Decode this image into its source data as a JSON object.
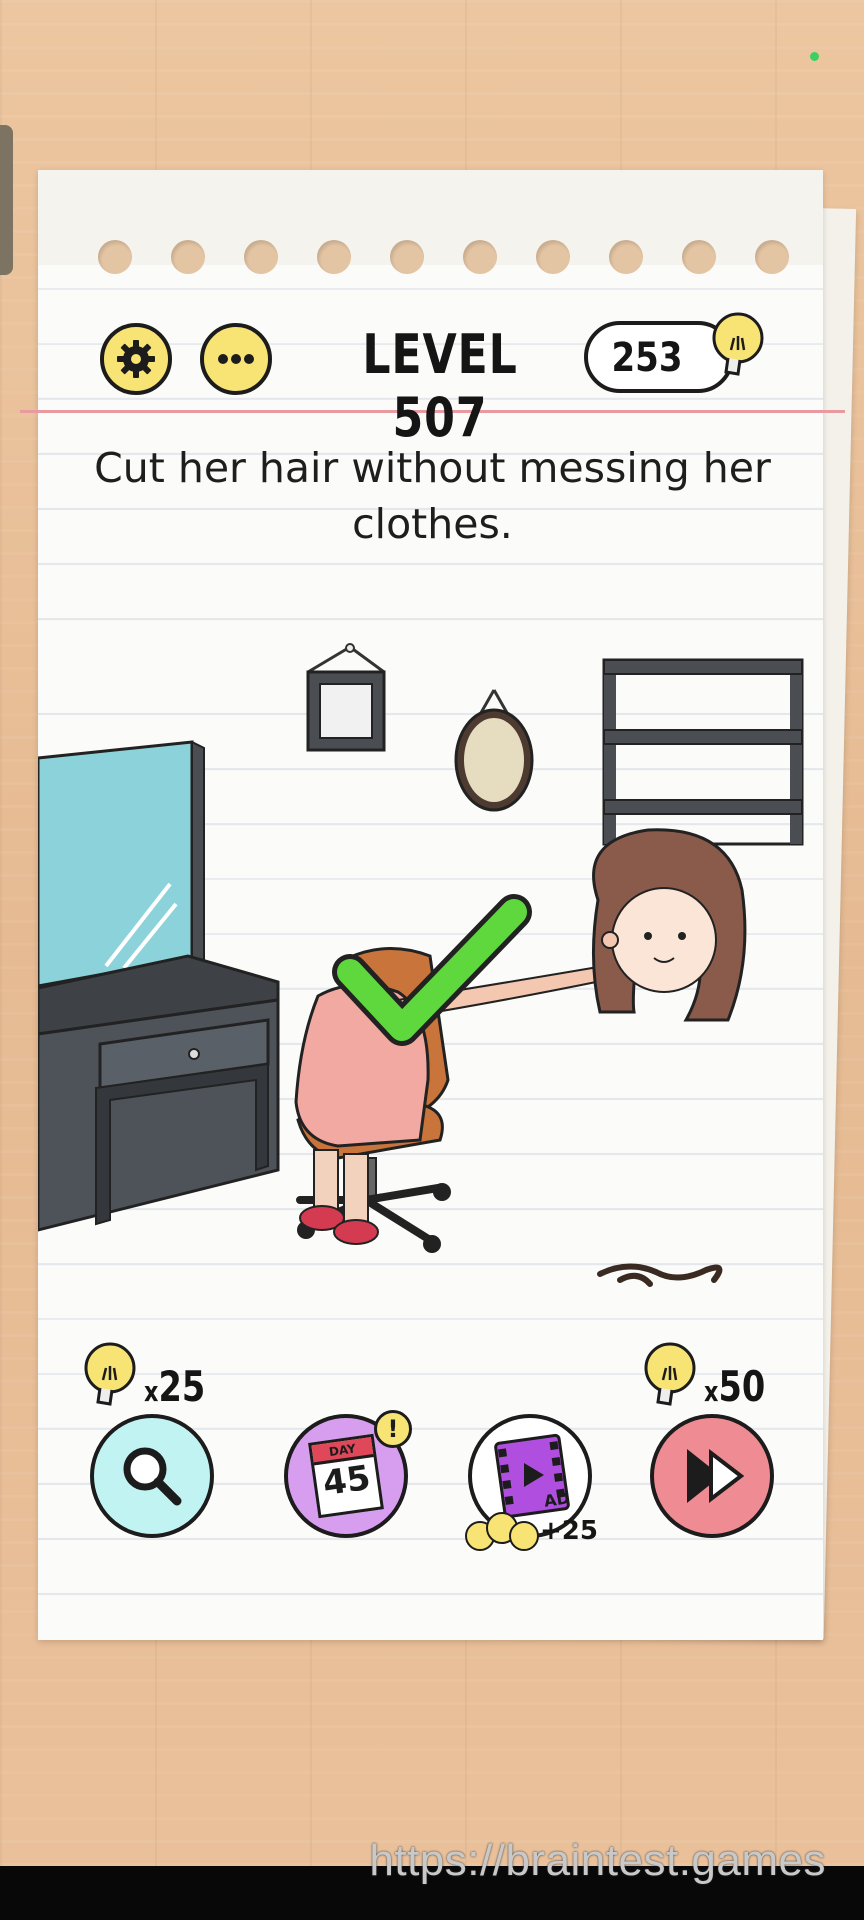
{
  "header": {
    "level_label": "LEVEL 507",
    "hint_count": "253"
  },
  "puzzle": {
    "instruction": "Cut her hair without messing her clothes."
  },
  "toolbar": {
    "magnifier_cost": "25",
    "skip_cost": "50",
    "daily_day_label": "DAY",
    "daily_day_number": "45",
    "daily_alert": "!",
    "ad_label": "AD",
    "ad_reward": "+25"
  },
  "footer": {
    "url": "https://braintest.games"
  },
  "icons": {
    "settings": "gear-icon",
    "more": "ellipsis-icon",
    "hint": "lightbulb-icon",
    "search": "magnifier-icon",
    "daily": "calendar-icon",
    "video": "film-icon",
    "skip": "fast-forward-icon",
    "success": "checkmark-icon"
  },
  "colors": {
    "button_yellow": "#f8e474",
    "search_bg": "#c2f3f3",
    "daily_bg": "#d79ef0",
    "skip_bg": "#ef8c93",
    "checkmark": "#5ed83c",
    "margin_line": "#e89aa0"
  }
}
